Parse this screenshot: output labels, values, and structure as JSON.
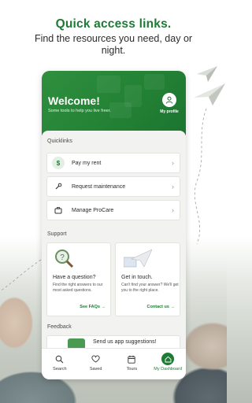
{
  "promo": {
    "headline": "Quick access links.",
    "subline": "Find the resources you need, day or night."
  },
  "hero": {
    "welcome": "Welcome!",
    "tagline": "Some tools to help you live freer.",
    "profile_label": "My profile"
  },
  "quicklinks": {
    "title": "Quicklinks",
    "items": [
      {
        "label": "Pay my rent",
        "icon": "dollar-icon"
      },
      {
        "label": "Request maintenance",
        "icon": "wrench-icon"
      },
      {
        "label": "Manage ProCare",
        "icon": "briefcase-icon"
      }
    ]
  },
  "support": {
    "title": "Support",
    "cards": [
      {
        "title": "Have a question?",
        "description": "Find the right answers to our most asked questions.",
        "link": "See FAQs",
        "icon": "magnifier-icon"
      },
      {
        "title": "Get in touch.",
        "description": "Can't find your answer? We'll get you to the right place.",
        "link": "Contact us",
        "icon": "paper-plane-icon"
      }
    ]
  },
  "feedback": {
    "title": "Feedback",
    "text": "Send us app suggestions!"
  },
  "tabbar": {
    "tabs": [
      {
        "label": "Search",
        "icon": "search-icon",
        "active": false
      },
      {
        "label": "Saved",
        "icon": "heart-icon",
        "active": false
      },
      {
        "label": "Tours",
        "icon": "calendar-icon",
        "active": false
      },
      {
        "label": "My Dashboard",
        "icon": "home-icon",
        "active": true
      }
    ]
  },
  "colors": {
    "brand_green": "#1f7a36",
    "hero_green": "#238234"
  }
}
